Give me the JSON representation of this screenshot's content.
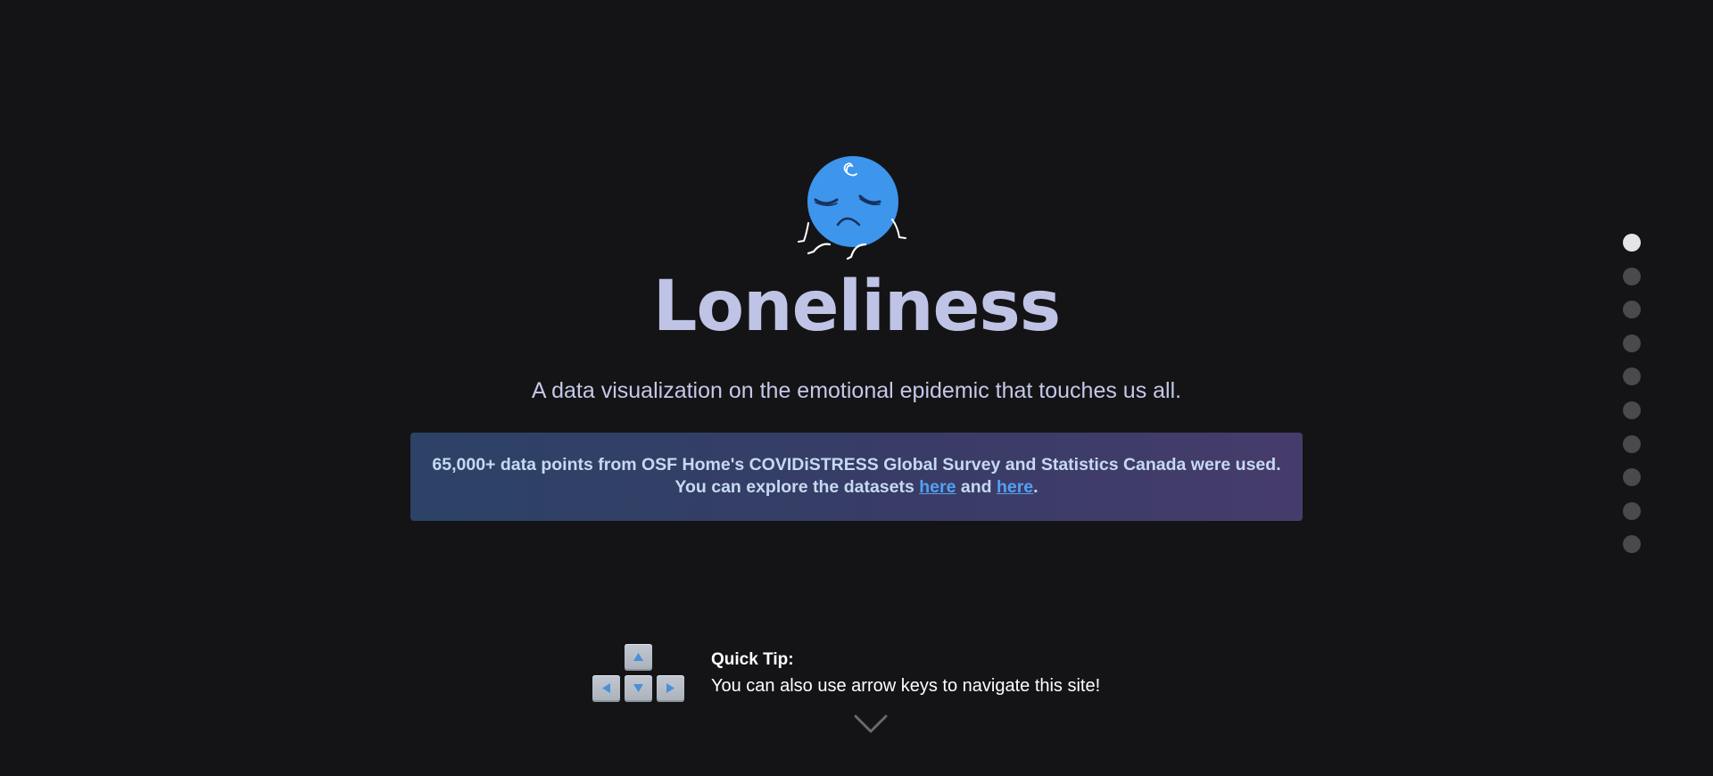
{
  "hero": {
    "title": "Loneliness",
    "subtitle": "A data visualization on the emotional epidemic that touches us all.",
    "mascot_icon": "sad-blue-ball-icon"
  },
  "info_box": {
    "text_before": "65,000+ data points from OSF Home's COVIDiSTRESS Global Survey and Statistics Canada were used. You can explore the datasets ",
    "link1": "here",
    "text_middle": " and ",
    "link2": "here",
    "text_end": "."
  },
  "tip": {
    "label": "Quick Tip:",
    "text": "You can also use arrow keys to navigate this site!",
    "keys_icon": "arrow-keys-icon"
  },
  "scroll_icon": "chevron-down-icon",
  "nav": {
    "section_count": 10,
    "active_index": 0
  },
  "colors": {
    "background": "#141416",
    "title": "#bfc4e6",
    "mascot": "#3d95ec",
    "link": "#52a1f3",
    "dot_active": "#e5e5e5",
    "dot_inactive": "#4a4a4c"
  }
}
